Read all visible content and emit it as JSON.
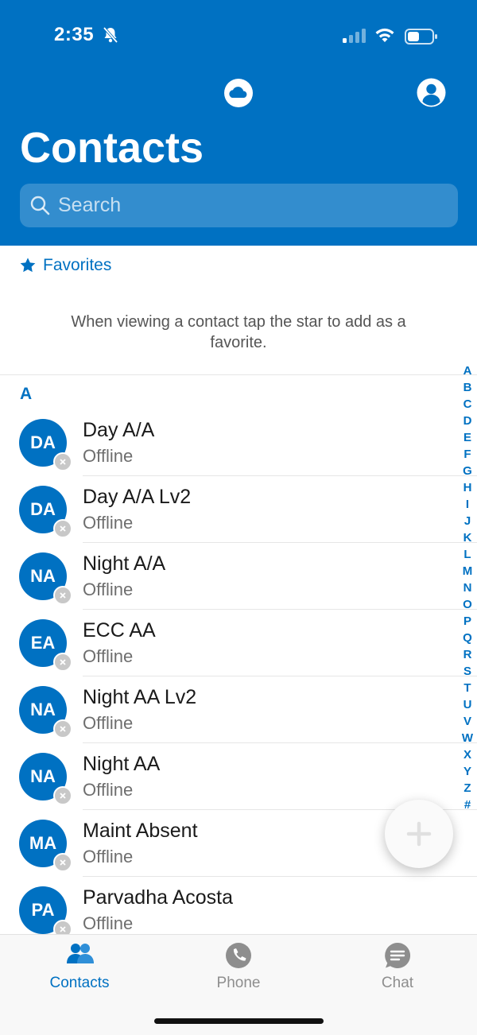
{
  "status_bar": {
    "time": "2:35"
  },
  "header": {
    "title": "Contacts"
  },
  "search": {
    "placeholder": "Search"
  },
  "favorites": {
    "label": "Favorites",
    "hint": "When viewing a contact tap the star to add as a favorite."
  },
  "section": {
    "letter": "A"
  },
  "contacts": [
    {
      "initials": "DA",
      "name": "Day A/A",
      "status": "Offline"
    },
    {
      "initials": "DA",
      "name": "Day A/A Lv2",
      "status": "Offline"
    },
    {
      "initials": "NA",
      "name": "Night A/A",
      "status": "Offline"
    },
    {
      "initials": "EA",
      "name": "ECC AA",
      "status": "Offline"
    },
    {
      "initials": "NA",
      "name": "Night AA Lv2",
      "status": "Offline"
    },
    {
      "initials": "NA",
      "name": "Night AA",
      "status": "Offline"
    },
    {
      "initials": "MA",
      "name": "Maint Absent",
      "status": "Offline"
    },
    {
      "initials": "PA",
      "name": "Parvadha Acosta",
      "status": "Offline"
    }
  ],
  "index": [
    "A",
    "B",
    "C",
    "D",
    "E",
    "F",
    "G",
    "H",
    "I",
    "J",
    "K",
    "L",
    "M",
    "N",
    "O",
    "P",
    "Q",
    "R",
    "S",
    "T",
    "U",
    "V",
    "W",
    "X",
    "Y",
    "Z",
    "#"
  ],
  "tabs": [
    {
      "label": "Contacts",
      "icon": "people-icon",
      "active": true
    },
    {
      "label": "Phone",
      "icon": "phone-icon",
      "active": false
    },
    {
      "label": "Chat",
      "icon": "chat-bubble-icon",
      "active": false
    }
  ],
  "colors": {
    "brand": "#0071c2",
    "inactive_tab": "#8e8e8e",
    "presence_offline": "#c8c8c8"
  }
}
